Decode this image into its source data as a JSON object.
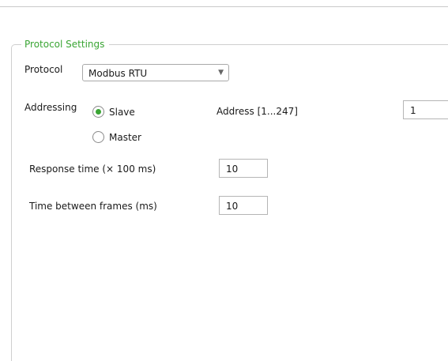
{
  "group": {
    "legend": "Protocol Settings"
  },
  "protocol": {
    "label": "Protocol",
    "selected": "Modbus RTU"
  },
  "addressing": {
    "label": "Addressing",
    "options": [
      {
        "label": "Slave",
        "checked": true
      },
      {
        "label": "Master",
        "checked": false
      }
    ],
    "address_label": "Address [1...247]",
    "address_value": "1"
  },
  "response_time": {
    "label": "Response time (× 100 ms)",
    "value": "10"
  },
  "time_between_frames": {
    "label": "Time between frames (ms)",
    "value": "10"
  },
  "colors": {
    "accent": "#3aa534",
    "border": "#b5b5b5"
  },
  "icons": {
    "select_arrow": "chevron-down-icon"
  }
}
